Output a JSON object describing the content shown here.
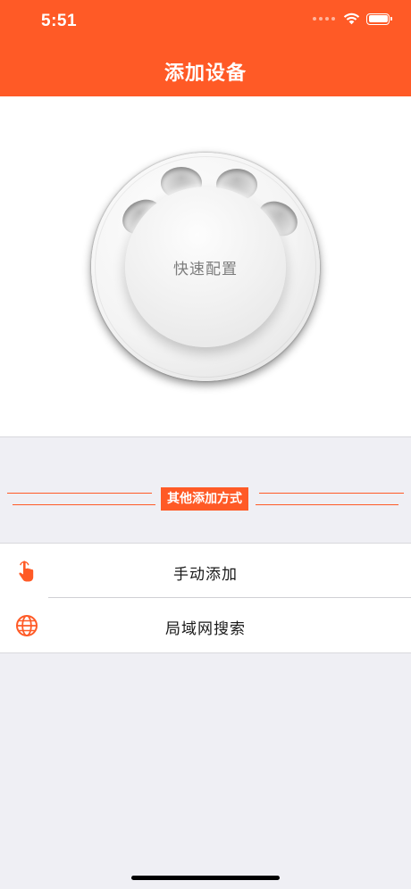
{
  "status_bar": {
    "time": "5:51",
    "icons": [
      "signal-dots-icon",
      "wifi-icon",
      "battery-icon"
    ]
  },
  "header": {
    "title": "添加设备",
    "background_color": "#ff5a26"
  },
  "quick_config": {
    "label": "快速配置"
  },
  "other_methods": {
    "label": "其他添加方式"
  },
  "options": [
    {
      "label": "手动添加",
      "icon": "hand-pointer-icon"
    },
    {
      "label": "局域网搜索",
      "icon": "globe-icon"
    }
  ],
  "colors": {
    "accent": "#ff5a26",
    "background": "#efeff4",
    "surface": "#ffffff"
  }
}
